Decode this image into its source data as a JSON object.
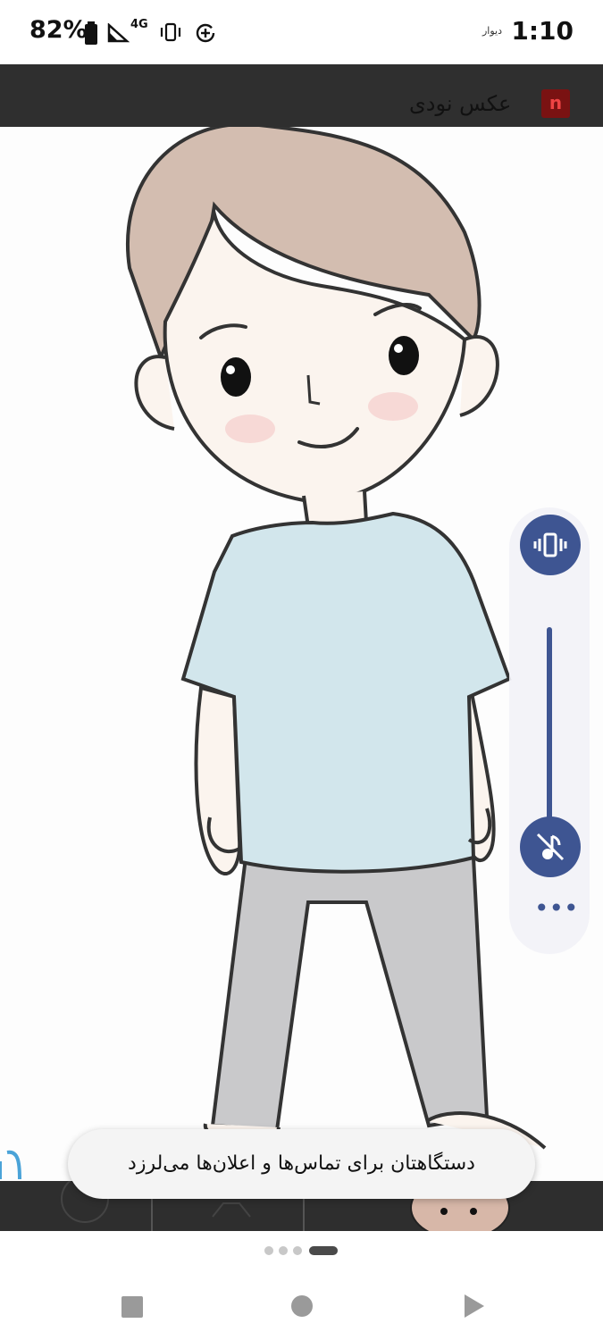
{
  "status_bar": {
    "battery_percent": "82%",
    "network": "4G",
    "app_indicator": "دیوار",
    "time": "1:10",
    "icons": [
      "battery-icon",
      "signal-icon",
      "vibrate-icon",
      "data-saver-icon"
    ]
  },
  "app_bar": {
    "title": "عکس نودی",
    "logo_letter": "n"
  },
  "volume_panel": {
    "ringer_mode": "vibrate",
    "icons": [
      "vibrate-icon",
      "music-muted-icon",
      "more-icon"
    ],
    "more_label": "•••"
  },
  "toast": {
    "message": "دستگاهتان برای تماس‌ها و اعلان‌ها می‌لرزد"
  },
  "pager": {
    "count": 4,
    "active_index": 3
  },
  "nav_bar": {
    "icons": [
      "recents-square-icon",
      "home-circle-icon",
      "back-triangle-icon"
    ]
  },
  "colors": {
    "accent": "#3e5592",
    "appbar": "#2f2f2f",
    "shirt": "#d2e6ec",
    "pants": "#c9c9cb",
    "hair": "#d3bdb0",
    "skin": "#fbf4ee"
  }
}
